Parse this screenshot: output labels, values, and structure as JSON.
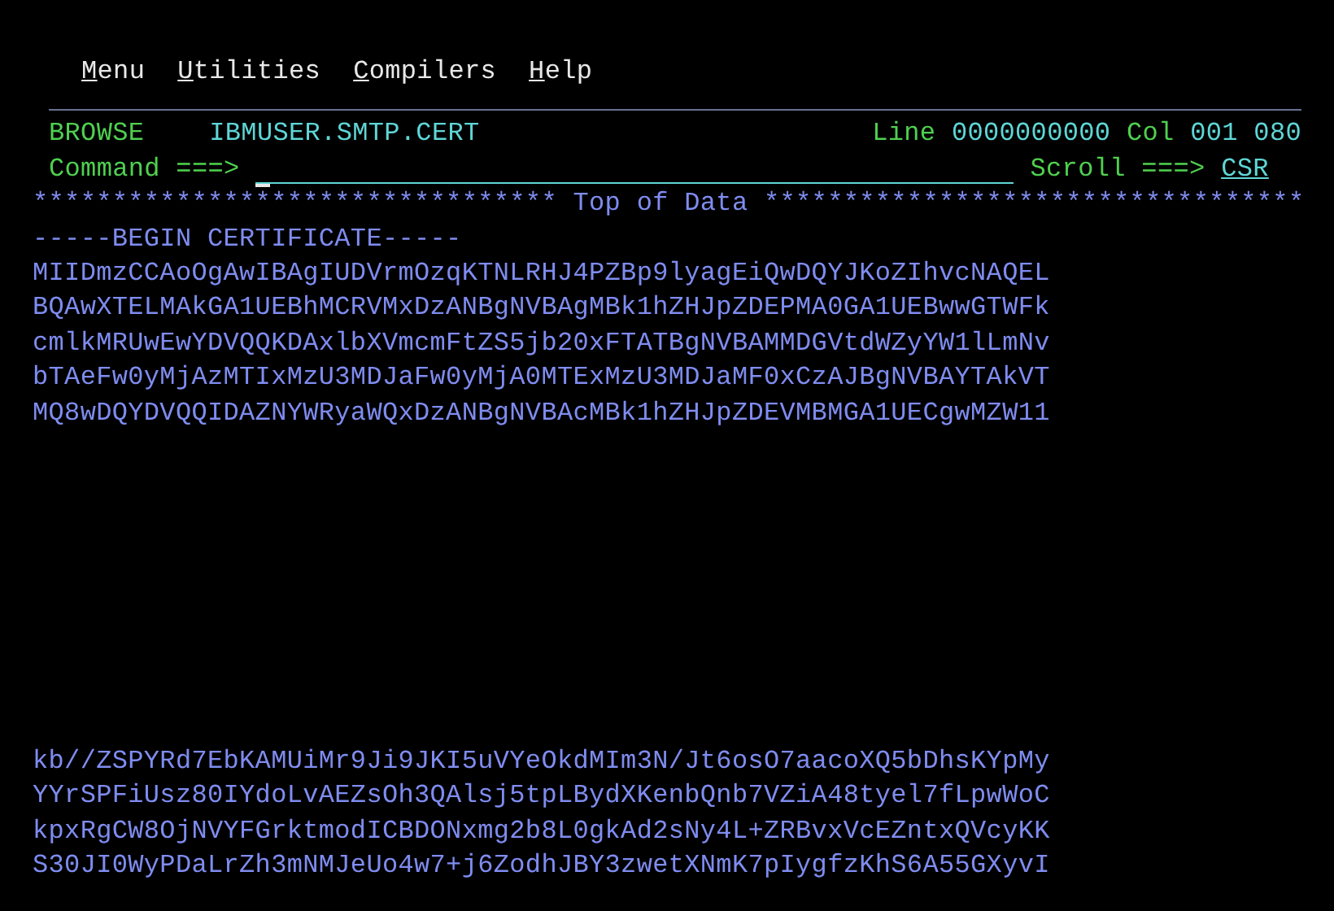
{
  "menu_bar": [
    {
      "label": "Menu"
    },
    {
      "label": "Utilities"
    },
    {
      "label": "Compilers"
    },
    {
      "label": "Help"
    }
  ],
  "header": {
    "mode": "BROWSE",
    "dataset": "IBMUSER.SMTP.CERT",
    "line_label": "Line",
    "line_value": "0000000000",
    "col_label": "Col",
    "col_value": "001 080"
  },
  "command": {
    "label": "Command ===>",
    "scroll_label": "Scroll ===>",
    "scroll_value": "CSR"
  },
  "data": {
    "top_marker": "********************************* Top of Data **********************************",
    "lines_before_gap": [
      "-----BEGIN CERTIFICATE-----",
      "MIIDmzCCAoOgAwIBAgIUDVrmOzqKTNLRHJ4PZBp9lyagEiQwDQYJKoZIhvcNAQEL",
      "BQAwXTELMAkGA1UEBhMCRVMxDzANBgNVBAgMBk1hZHJpZDEPMA0GA1UEBwwGTWFk",
      "cmlkMRUwEwYDVQQKDAxlbXVmcmFtZS5jb20xFTATBgNVBAMMDGVtdWZyYW1lLmNv",
      "bTAeFw0yMjAzMTIxMzU3MDJaFw0yMjA0MTExMzU3MDJaMF0xCzAJBgNVBAYTAkVT",
      "MQ8wDQYDVQQIDAZNYWRyaWQxDzANBgNVBAcMBk1hZHJpZDEVMBMGA1UECgwMZW11"
    ],
    "lines_after_gap": [
      "kb//ZSPYRd7EbKAMUiMr9Ji9JKI5uVYeOkdMIm3N/Jt6osO7aacoXQ5bDhsKYpMy",
      "YYrSPFiUsz80IYdoLvAEZsOh3QAlsj5tpLBydXKenbQnb7VZiA48tyel7fLpwWoC",
      "kpxRgCW8OjNVYFGrktmodICBDONxmg2b8L0gkAd2sNy4L+ZRBvxVcEZntxQVcyKK",
      "S30JI0WyPDaLrZh3mNMJeUo4w7+j6ZodhJBY3zwetXNmK7pIygfzKhS6A55GXyvI"
    ]
  }
}
